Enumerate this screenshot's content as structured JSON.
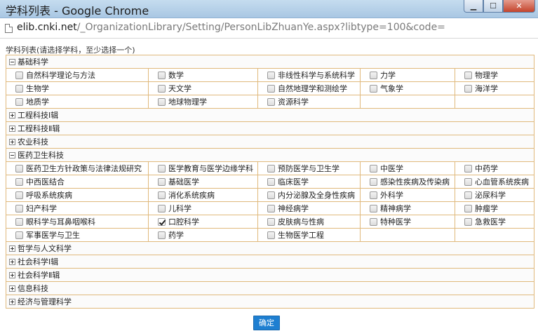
{
  "window": {
    "title": "学科列表 - Google Chrome"
  },
  "address": {
    "host": "elib.cnki.net",
    "path": "/_OrganizationLibrary/Setting/PersonLibZhuanYe.aspx?libtype=100&code="
  },
  "caption": "学科列表(请选择学科，至少选择一个)",
  "groups": [
    {
      "name": "基础科学",
      "expanded": true,
      "items": [
        {
          "label": "自然科学理论与方法",
          "checked": false
        },
        {
          "label": "数学",
          "checked": false
        },
        {
          "label": "非线性科学与系统科学",
          "checked": false
        },
        {
          "label": "力学",
          "checked": false
        },
        {
          "label": "物理学",
          "checked": false
        },
        {
          "label": "生物学",
          "checked": false
        },
        {
          "label": "天文学",
          "checked": false
        },
        {
          "label": "自然地理学和测绘学",
          "checked": false
        },
        {
          "label": "气象学",
          "checked": false
        },
        {
          "label": "海洋学",
          "checked": false
        },
        {
          "label": "地质学",
          "checked": false
        },
        {
          "label": "地球物理学",
          "checked": false
        },
        {
          "label": "资源科学",
          "checked": false
        }
      ]
    },
    {
      "name": "工程科技Ⅰ辑",
      "expanded": false,
      "items": []
    },
    {
      "name": "工程科技Ⅱ辑",
      "expanded": false,
      "items": []
    },
    {
      "name": "农业科技",
      "expanded": false,
      "items": []
    },
    {
      "name": "医药卫生科技",
      "expanded": true,
      "items": [
        {
          "label": "医药卫生方针政策与法律法规研究",
          "checked": false
        },
        {
          "label": "医学教育与医学边缘学科",
          "checked": false
        },
        {
          "label": "预防医学与卫生学",
          "checked": false
        },
        {
          "label": "中医学",
          "checked": false
        },
        {
          "label": "中药学",
          "checked": false
        },
        {
          "label": "中西医结合",
          "checked": false
        },
        {
          "label": "基础医学",
          "checked": false
        },
        {
          "label": "临床医学",
          "checked": false
        },
        {
          "label": "感染性疾病及传染病",
          "checked": false
        },
        {
          "label": "心血管系统疾病",
          "checked": false
        },
        {
          "label": "呼吸系统疾病",
          "checked": false
        },
        {
          "label": "消化系统疾病",
          "checked": false
        },
        {
          "label": "内分泌腺及全身性疾病",
          "checked": false
        },
        {
          "label": "外科学",
          "checked": false
        },
        {
          "label": "泌尿科学",
          "checked": false
        },
        {
          "label": "妇产科学",
          "checked": false
        },
        {
          "label": "儿科学",
          "checked": false
        },
        {
          "label": "神经病学",
          "checked": false
        },
        {
          "label": "精神病学",
          "checked": false
        },
        {
          "label": "肿瘤学",
          "checked": false
        },
        {
          "label": "眼科学与耳鼻咽喉科",
          "checked": false
        },
        {
          "label": "口腔科学",
          "checked": true
        },
        {
          "label": "皮肤病与性病",
          "checked": false
        },
        {
          "label": "特种医学",
          "checked": false
        },
        {
          "label": "急救医学",
          "checked": false
        },
        {
          "label": "军事医学与卫生",
          "checked": false
        },
        {
          "label": "药学",
          "checked": false
        },
        {
          "label": "生物医学工程",
          "checked": false
        }
      ]
    },
    {
      "name": "哲学与人文科学",
      "expanded": false,
      "items": []
    },
    {
      "name": "社会科学Ⅰ辑",
      "expanded": false,
      "items": []
    },
    {
      "name": "社会科学Ⅱ辑",
      "expanded": false,
      "items": []
    },
    {
      "name": "信息科技",
      "expanded": false,
      "items": []
    },
    {
      "name": "经济与管理科学",
      "expanded": false,
      "items": []
    }
  ],
  "ok_label": "确定"
}
